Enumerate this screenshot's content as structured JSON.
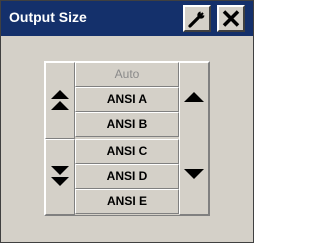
{
  "window": {
    "title": "Output Size"
  },
  "titlebar": {
    "buttons": [
      {
        "icon": "wrench-icon"
      },
      {
        "icon": "close-icon"
      }
    ]
  },
  "size_list": {
    "items": [
      {
        "label": "Auto",
        "enabled": false
      },
      {
        "label": "ANSI A",
        "enabled": true
      },
      {
        "label": "ANSI B",
        "enabled": true
      },
      {
        "label": "ANSI C",
        "enabled": true
      },
      {
        "label": "ANSI D",
        "enabled": true
      },
      {
        "label": "ANSI E",
        "enabled": true
      }
    ]
  },
  "scroll_buttons": {
    "first": {
      "icon": "double-up-arrow-icon"
    },
    "last": {
      "icon": "double-down-arrow-icon"
    },
    "step": {
      "up_icon": "up-arrow-icon",
      "down_icon": "down-arrow-icon"
    }
  },
  "colors": {
    "titlebar": "#14306b",
    "face": "#d4d0c8",
    "disabled_text": "#8a8a8a"
  }
}
